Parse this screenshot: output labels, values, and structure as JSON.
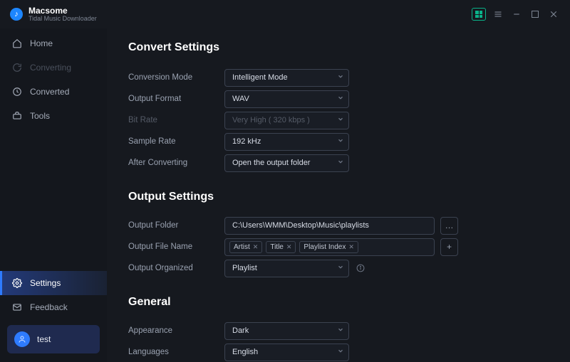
{
  "brand": {
    "name": "Macsome",
    "subtitle": "Tidal Music Downloader"
  },
  "sidebar": {
    "items": [
      {
        "label": "Home"
      },
      {
        "label": "Converting"
      },
      {
        "label": "Converted"
      },
      {
        "label": "Tools"
      },
      {
        "label": "Settings"
      },
      {
        "label": "Feedback"
      }
    ],
    "user": "test"
  },
  "sections": {
    "convert": {
      "title": "Convert Settings",
      "labels": {
        "mode": "Conversion Mode",
        "format": "Output Format",
        "bitrate": "Bit Rate",
        "sample": "Sample Rate",
        "after": "After Converting"
      },
      "values": {
        "mode": "Intelligent Mode",
        "format": "WAV",
        "bitrate": "Very High ( 320 kbps )",
        "sample": "192 kHz",
        "after": "Open the output folder"
      }
    },
    "output": {
      "title": "Output Settings",
      "labels": {
        "folder": "Output Folder",
        "filename": "Output File Name",
        "organized": "Output Organized"
      },
      "folder": "C:\\Users\\WMM\\Desktop\\Music\\playlists",
      "tags": {
        "artist": "Artist",
        "title": "Title",
        "playlist": "Playlist Index"
      },
      "organized": "Playlist"
    },
    "general": {
      "title": "General",
      "labels": {
        "appearance": "Appearance",
        "languages": "Languages"
      },
      "appearance": "Dark",
      "languages": "English"
    }
  },
  "glyphs": {
    "ellipsis": "…",
    "plus": "+",
    "logo": "♪"
  }
}
